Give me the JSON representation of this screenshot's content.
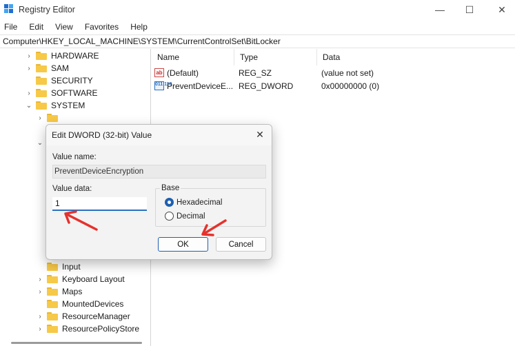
{
  "window": {
    "title": "Registry Editor",
    "min_glyph": "—",
    "max_glyph": "☐",
    "close_glyph": "✕"
  },
  "menu": [
    "File",
    "Edit",
    "View",
    "Favorites",
    "Help"
  ],
  "address": "Computer\\HKEY_LOCAL_MACHINE\\SYSTEM\\CurrentControlSet\\BitLocker",
  "tree": {
    "top_items": [
      {
        "label": "HARDWARE",
        "chevron": "›"
      },
      {
        "label": "SAM",
        "chevron": "›"
      },
      {
        "label": "SECURITY",
        "chevron": ""
      },
      {
        "label": "SOFTWARE",
        "chevron": "›"
      },
      {
        "label": "SYSTEM",
        "chevron": "⌄"
      }
    ],
    "bottom_items": [
      {
        "label": "Input",
        "chevron": ""
      },
      {
        "label": "Keyboard Layout",
        "chevron": "›"
      },
      {
        "label": "Maps",
        "chevron": "›"
      },
      {
        "label": "MountedDevices",
        "chevron": ""
      },
      {
        "label": "ResourceManager",
        "chevron": "›"
      },
      {
        "label": "ResourcePolicyStore",
        "chevron": "›"
      }
    ]
  },
  "list": {
    "columns": [
      "Name",
      "Type",
      "Data"
    ],
    "rows": [
      {
        "name": "(Default)",
        "type": "REG_SZ",
        "data": "(value not set)",
        "icon": "string-value-icon",
        "icon_text": "ab"
      },
      {
        "name": "PreventDeviceE...",
        "type": "REG_DWORD",
        "data": "0x00000000 (0)",
        "icon": "binary-value-icon",
        "icon_text": "011 110"
      }
    ]
  },
  "dialog": {
    "title": "Edit DWORD (32-bit) Value",
    "close_glyph": "✕",
    "value_name_label": "Value name:",
    "value_name": "PreventDeviceEncryption",
    "value_data_label": "Value data:",
    "value_data": "1",
    "base_label": "Base",
    "base_options": [
      {
        "label": "Hexadecimal",
        "selected": true
      },
      {
        "label": "Decimal",
        "selected": false
      }
    ],
    "ok_label": "OK",
    "cancel_label": "Cancel"
  },
  "colors": {
    "annotation_arrow": "#e5322d",
    "accent": "#1f5fb0",
    "folder": "#f7c948"
  }
}
